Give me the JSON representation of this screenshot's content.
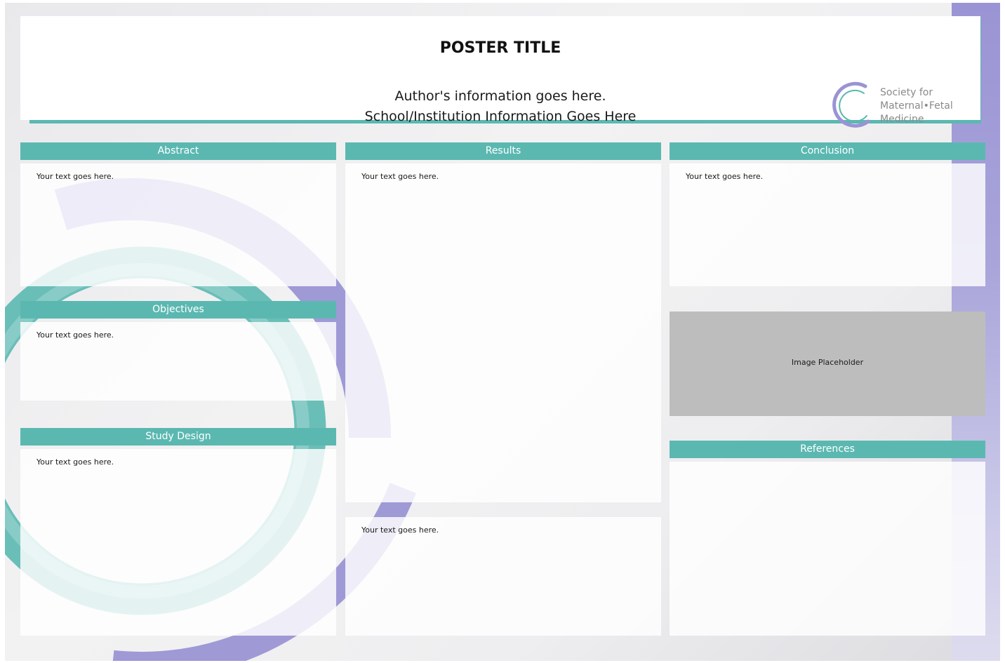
{
  "header": {
    "title": "POSTER TITLE",
    "author_line": "Author's information goes here.",
    "institution_line": "School/Institution Information Goes Here"
  },
  "logo": {
    "line1": "Society for",
    "line2": "Maternal•Fetal",
    "line3": "Medicine"
  },
  "sections": {
    "abstract": {
      "label": "Abstract",
      "body": "Your text goes here."
    },
    "objectives": {
      "label": "Objectives",
      "body": "Your text goes here."
    },
    "study_design": {
      "label": "Study Design",
      "body": "Your text goes here."
    },
    "results": {
      "label": "Results",
      "body": "Your text goes here.",
      "body2": "Your text goes here."
    },
    "conclusion": {
      "label": "Conclusion",
      "body": "Your text goes here."
    },
    "references": {
      "label": "References"
    }
  },
  "image_placeholder": {
    "label": "Image Placeholder"
  },
  "colors": {
    "teal": "#5bb8b1",
    "purple": "#9a94d4",
    "placeholder_gray": "#bdbdbd"
  }
}
